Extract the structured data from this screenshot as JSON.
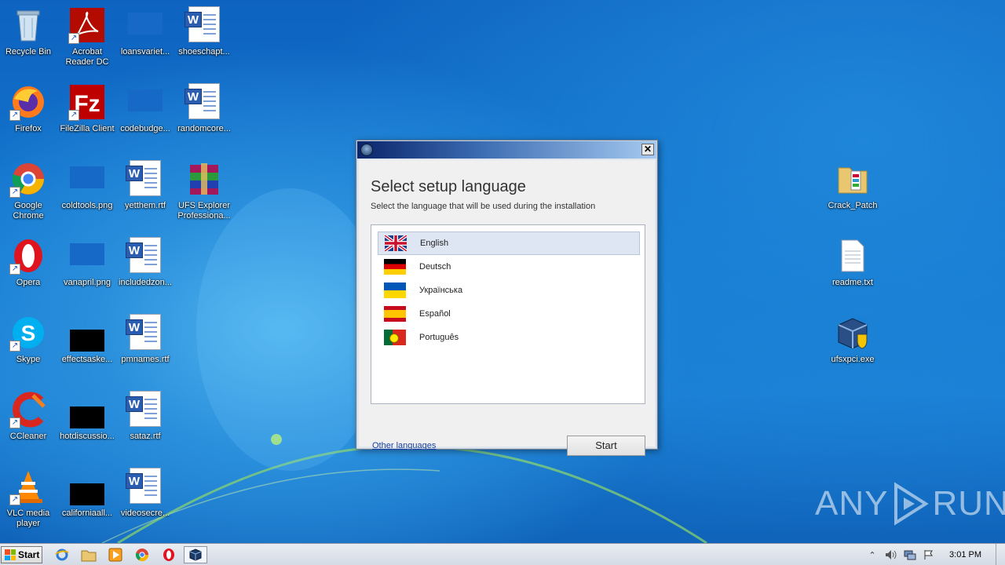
{
  "desktop": {
    "icons": [
      {
        "label": "Recycle Bin"
      },
      {
        "label": "Acrobat Reader DC"
      },
      {
        "label": "loansvariet..."
      },
      {
        "label": "shoeschapt..."
      },
      {
        "label": "Firefox"
      },
      {
        "label": "FileZilla Client"
      },
      {
        "label": "codebudge..."
      },
      {
        "label": "randomcore..."
      },
      {
        "label": "Google Chrome"
      },
      {
        "label": "coldtools.png"
      },
      {
        "label": "yetthem.rtf"
      },
      {
        "label": "UFS Explorer Professiona..."
      },
      {
        "label": "Opera"
      },
      {
        "label": "vanapril.png"
      },
      {
        "label": "includedzon..."
      },
      {
        "label": "Skype"
      },
      {
        "label": "effectsaske..."
      },
      {
        "label": "pmnames.rtf"
      },
      {
        "label": "CCleaner"
      },
      {
        "label": "hotdiscussio..."
      },
      {
        "label": "sataz.rtf"
      },
      {
        "label": "VLC media player"
      },
      {
        "label": "californiaall..."
      },
      {
        "label": "videosecre..."
      },
      {
        "label": "Crack_Patch"
      },
      {
        "label": "readme.txt"
      },
      {
        "label": "ufsxpci.exe"
      }
    ]
  },
  "dialog": {
    "heading": "Select setup language",
    "subtitle": "Select the language that will be used during the installation",
    "close_label": "✕",
    "languages": [
      {
        "name": "English",
        "flag": "uk-flag-icon",
        "selected": true
      },
      {
        "name": "Deutsch",
        "flag": "germany-flag-icon"
      },
      {
        "name": "Українська",
        "flag": "ukraine-flag-icon"
      },
      {
        "name": "Español",
        "flag": "spain-flag-icon"
      },
      {
        "name": "Português",
        "flag": "portugal-flag-icon"
      }
    ],
    "other_languages": "Other languages",
    "start_label": "Start"
  },
  "watermark": {
    "left": "ANY",
    "right": "RUN"
  },
  "taskbar": {
    "start_label": "Start",
    "pinned": [
      "internet-explorer-icon",
      "explorer-folder-icon",
      "media-player-icon",
      "chrome-icon",
      "opera-icon",
      "installer-app-icon"
    ],
    "clock": "3:01 PM"
  },
  "colors": {
    "dialog_title_start": "#0b246a",
    "dialog_title_end": "#a6caf0",
    "link": "#1a3fa0"
  }
}
